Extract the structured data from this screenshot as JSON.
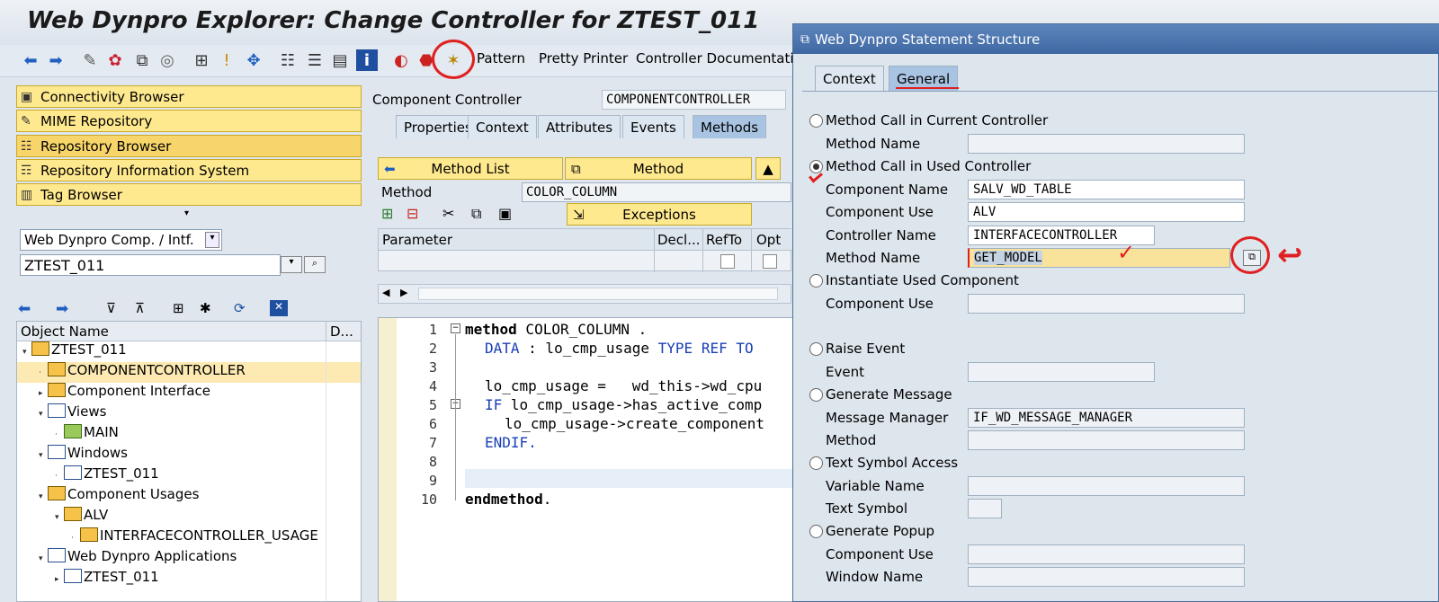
{
  "window": {
    "title": "Web Dynpro Explorer: Change Controller for ZTEST_011"
  },
  "toolbar": {
    "pattern": "Pattern",
    "pretty_printer": "Pretty Printer",
    "controller_doc": "Controller Documentation"
  },
  "nav_buttons": [
    {
      "label": "Connectivity Browser"
    },
    {
      "label": "MIME Repository"
    },
    {
      "label": "Repository Browser"
    },
    {
      "label": "Repository Information System"
    },
    {
      "label": "Tag Browser"
    }
  ],
  "object_selector": {
    "type": "Web Dynpro Comp. / Intf.",
    "name": "ZTEST_011"
  },
  "tree": {
    "col_name": "Object Name",
    "col_desc": "D...",
    "rows": [
      {
        "label": "ZTEST_011"
      },
      {
        "label": "COMPONENTCONTROLLER"
      },
      {
        "label": "Component Interface"
      },
      {
        "label": "Views"
      },
      {
        "label": "MAIN"
      },
      {
        "label": "Windows"
      },
      {
        "label": "ZTEST_011"
      },
      {
        "label": "Component Usages"
      },
      {
        "label": "ALV"
      },
      {
        "label": "INTERFACECONTROLLER_USAGE"
      },
      {
        "label": "Web Dynpro Applications"
      },
      {
        "label": "ZTEST_011"
      }
    ]
  },
  "controller": {
    "label": "Component Controller",
    "value": "COMPONENTCONTROLLER",
    "tabs": [
      "Properties",
      "Context",
      "Attributes",
      "Events",
      "Methods"
    ]
  },
  "method_panel": {
    "method_list": "Method List",
    "method": "Method",
    "method_label": "Method",
    "method_value": "COLOR_COLUMN",
    "exceptions": "Exceptions",
    "param_cols": [
      "Parameter",
      "Decl...",
      "RefTo",
      "Opt"
    ]
  },
  "code": {
    "line_numbers": [
      "1",
      "2",
      "3",
      "4",
      "5",
      "6",
      "7",
      "8",
      "9",
      "10"
    ],
    "line1_kw": "method",
    "line1_rest": " COLOR_COLUMN .",
    "line2_kw": "DATA",
    "line2_mid": " : lo_cmp_usage ",
    "line2_kw2": "TYPE REF TO",
    "line4": "lo_cmp_usage =   wd_this->wd_cpu",
    "line5_kw": "IF",
    "line5_rest": " lo_cmp_usage->has_active_comp",
    "line6": "lo_cmp_usage->create_component",
    "line7": "ENDIF.",
    "line10_kw": "endmethod",
    "line10_rest": "."
  },
  "dialog": {
    "title": "Web Dynpro Statement Structure",
    "tab_context": "Context",
    "tab_general": "General",
    "opt_current": "Method Call in Current Controller",
    "current_method_label": "Method Name",
    "opt_used": "Method Call in Used Controller",
    "comp_name_label": "Component Name",
    "comp_name_value": "SALV_WD_TABLE",
    "comp_use_label": "Component Use",
    "comp_use_value": "ALV",
    "ctrl_name_label": "Controller Name",
    "ctrl_name_value": "INTERFACECONTROLLER",
    "method_name_label": "Method Name",
    "method_name_value": "GET_MODEL",
    "opt_instantiate": "Instantiate Used Component",
    "inst_comp_use_label": "Component Use",
    "opt_raise": "Raise Event",
    "event_label": "Event",
    "opt_message": "Generate Message",
    "msg_mgr_label": "Message Manager",
    "msg_mgr_value": "IF_WD_MESSAGE_MANAGER",
    "msg_method_label": "Method",
    "opt_text": "Text Symbol Access",
    "var_name_label": "Variable Name",
    "text_symbol_label": "Text Symbol",
    "opt_popup": "Generate Popup",
    "popup_comp_use_label": "Component Use",
    "window_name_label": "Window Name"
  }
}
